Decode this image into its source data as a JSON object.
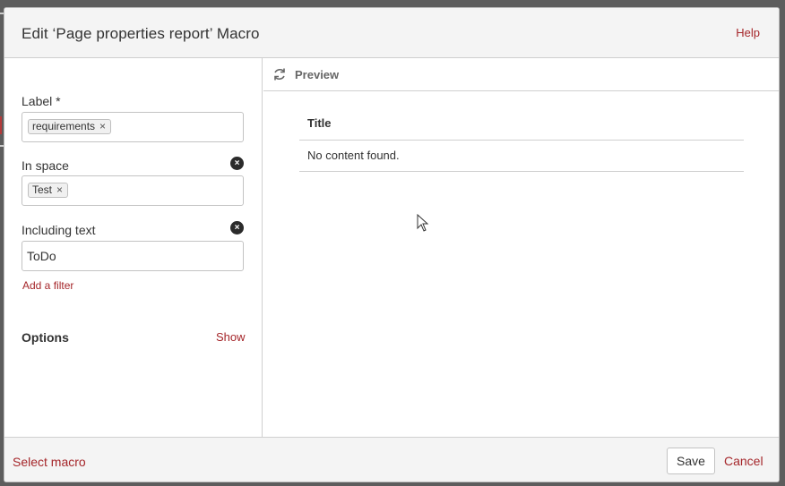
{
  "dialog": {
    "title": "Edit ‘Page properties report’ Macro",
    "help": "Help"
  },
  "form": {
    "label_field": {
      "label": "Label *",
      "tags": [
        "requirements"
      ]
    },
    "space_field": {
      "label": "In space",
      "tags": [
        "Test"
      ]
    },
    "text_field": {
      "label": "Including text",
      "value": "ToDo"
    },
    "add_filter": "Add a filter",
    "options": {
      "label": "Options",
      "show": "Show"
    }
  },
  "preview": {
    "label": "Preview",
    "table": {
      "header": "Title",
      "rows": [
        "No content found."
      ]
    }
  },
  "footer": {
    "select_macro": "Select macro",
    "save": "Save",
    "cancel": "Cancel"
  },
  "colors": {
    "link": "#a5262a",
    "header_bg": "#f4f4f4"
  },
  "icons": {
    "tag_remove": "×",
    "clear": "×"
  }
}
